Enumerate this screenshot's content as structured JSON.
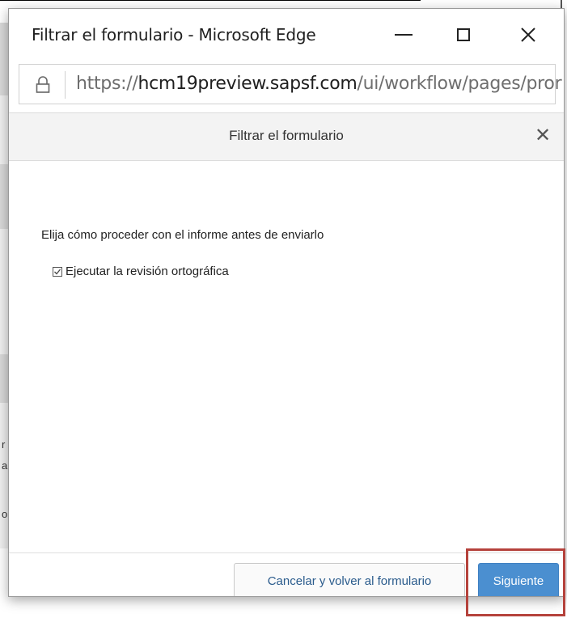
{
  "window": {
    "title": "Filtrar el formulario - Microsoft Edge",
    "controls": {
      "minimize": "—",
      "maximize": "☐",
      "close": "✕"
    }
  },
  "address_bar": {
    "url_scheme": "https://",
    "url_host": "hcm19preview.sapsf.com",
    "url_path": "/ui/workflow/pages/pror"
  },
  "dialog": {
    "title": "Filtrar el formulario",
    "close_glyph": "✕",
    "instruction": "Elija cómo proceder con el informe antes de enviarlo",
    "spellcheck": {
      "label": "Ejecutar la revisión ortográfica",
      "checked": true
    },
    "buttons": {
      "cancel": "Cancelar y volver al formulario",
      "next": "Siguiente"
    }
  },
  "background": {
    "fragments": [
      "r",
      "a",
      "o"
    ]
  },
  "colors": {
    "primary_button": "#4b8fd0",
    "highlight_border": "#b5423c",
    "header_bg": "#f3f3f3"
  },
  "icons": [
    "lock-icon",
    "minimize-icon",
    "maximize-icon",
    "close-icon",
    "checkbox-checked-icon"
  ]
}
